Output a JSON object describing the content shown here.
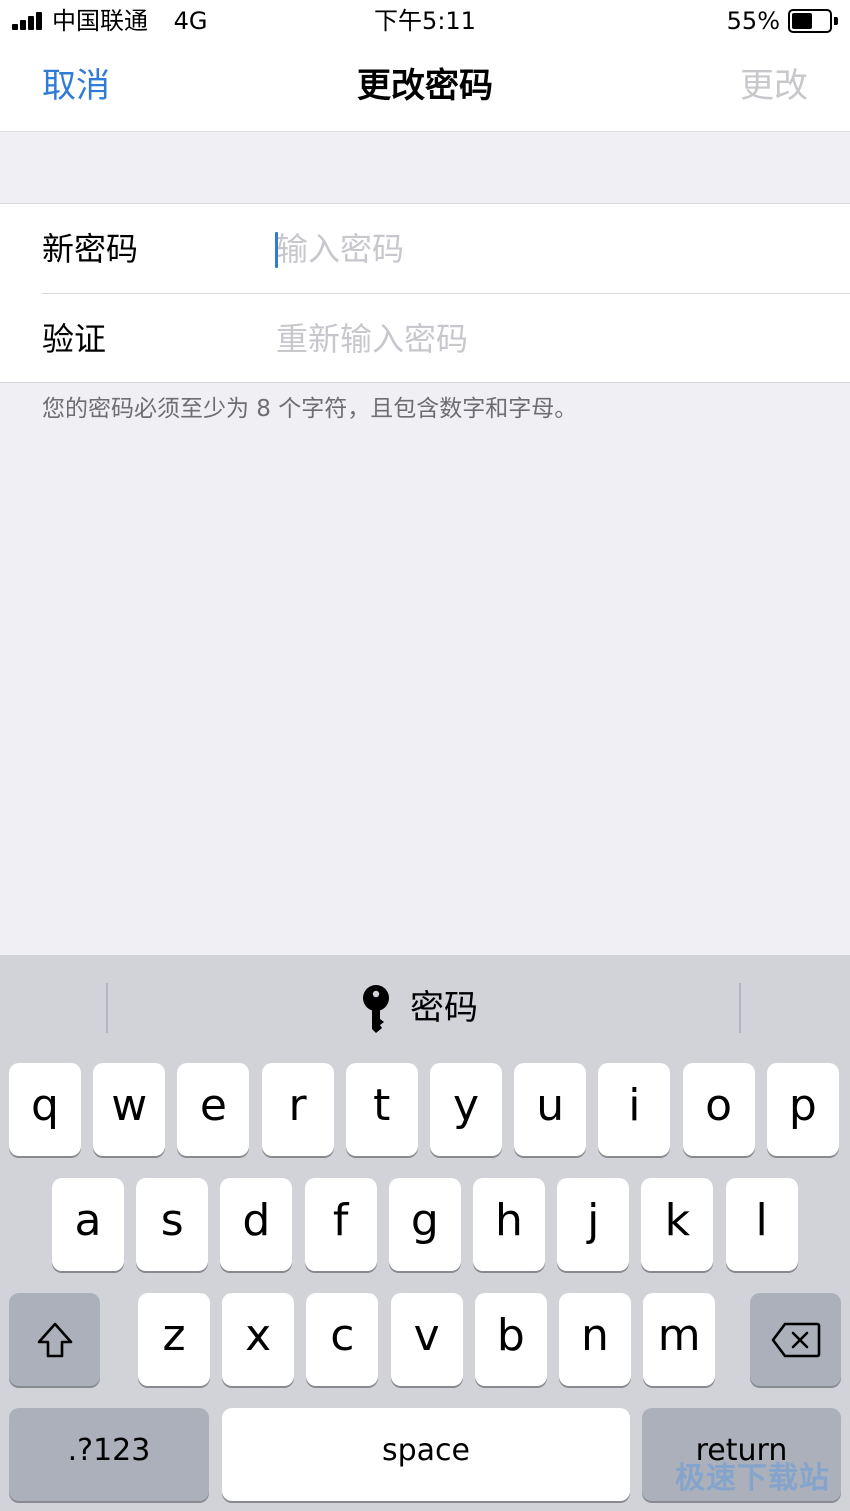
{
  "status_bar": {
    "carrier": "中国联通",
    "network": "4G",
    "time": "下午5:11",
    "battery_percent": "55%",
    "battery_level": 0.55
  },
  "nav": {
    "cancel_label": "取消",
    "title": "更改密码",
    "confirm_label": "更改"
  },
  "form": {
    "new_password": {
      "label": "新密码",
      "placeholder": "输入密码",
      "value": ""
    },
    "verify": {
      "label": "验证",
      "placeholder": "重新输入密码",
      "value": ""
    },
    "hint": "您的密码必须至少为 8 个字符，且包含数字和字母。"
  },
  "keyboard": {
    "suggestion": {
      "icon": "key-icon",
      "label": "密码"
    },
    "row1": [
      "q",
      "w",
      "e",
      "r",
      "t",
      "y",
      "u",
      "i",
      "o",
      "p"
    ],
    "row2": [
      "a",
      "s",
      "d",
      "f",
      "g",
      "h",
      "j",
      "k",
      "l"
    ],
    "row3": [
      "z",
      "x",
      "c",
      "v",
      "b",
      "n",
      "m"
    ],
    "shift_icon": "shift-arrow-icon",
    "delete_icon": "backspace-icon",
    "numbers_label": ".?123",
    "space_label": "space",
    "return_label": "return"
  },
  "watermark": "极速下载站",
  "colors": {
    "accent": "#2f7bd6",
    "disabled": "#c7c7cc",
    "background": "#efeff4",
    "keyboard_bg": "#d1d3d9"
  }
}
